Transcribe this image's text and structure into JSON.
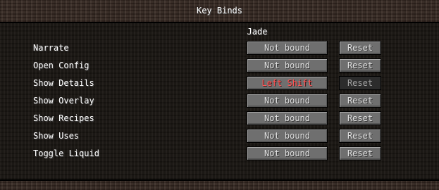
{
  "screen": {
    "title": "Key Binds",
    "category": "Jade"
  },
  "bindings": [
    {
      "label": "Narrate",
      "key": "Not bound",
      "reset": "Reset"
    },
    {
      "label": "Open Config",
      "key": "Not bound",
      "reset": "Reset"
    },
    {
      "label": "Show Details",
      "key": "Left Shift",
      "reset": "Reset"
    },
    {
      "label": "Show Overlay",
      "key": "Not bound",
      "reset": "Reset"
    },
    {
      "label": "Show Recipes",
      "key": "Not bound",
      "reset": "Reset"
    },
    {
      "label": "Show Uses",
      "key": "Not bound",
      "reset": "Reset"
    },
    {
      "label": "Toggle Liquid",
      "key": "Not bound",
      "reset": "Reset"
    }
  ],
  "colors": {
    "conflict_key": "#ff5555",
    "label": "#ffffff",
    "button_text": "#e0e0e0"
  }
}
